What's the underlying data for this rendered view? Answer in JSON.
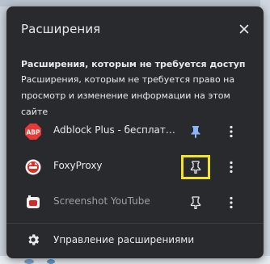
{
  "panel": {
    "title": "Расширения",
    "close_icon": "close-icon"
  },
  "section": {
    "heading": "Расширения, которым не требуется доступ",
    "description": "Расширения, которым не требуется право на просмотр и изменение информации на этом сайте"
  },
  "extensions": [
    {
      "name": "Adblock Plus - бесплатный блокировщик рекламы",
      "icon": "adblock-plus-icon",
      "pinned": true,
      "pin_color": "#8ab4f8"
    },
    {
      "name": "FoxyProxy",
      "icon": "foxyproxy-icon",
      "pinned": false,
      "highlighted": true
    },
    {
      "name": "Screenshot YouTube",
      "icon": "screenshot-youtube-icon",
      "pinned": false,
      "dimmed": true
    }
  ],
  "footer": {
    "manage_label": "Управление расширениями",
    "manage_icon": "gear-icon"
  },
  "colors": {
    "panel_bg": "#292a2d",
    "text": "#e8eaed",
    "accent_pin": "#8ab4f8",
    "highlight_box": "#f4e31f",
    "adblock_red": "#e53a35"
  }
}
